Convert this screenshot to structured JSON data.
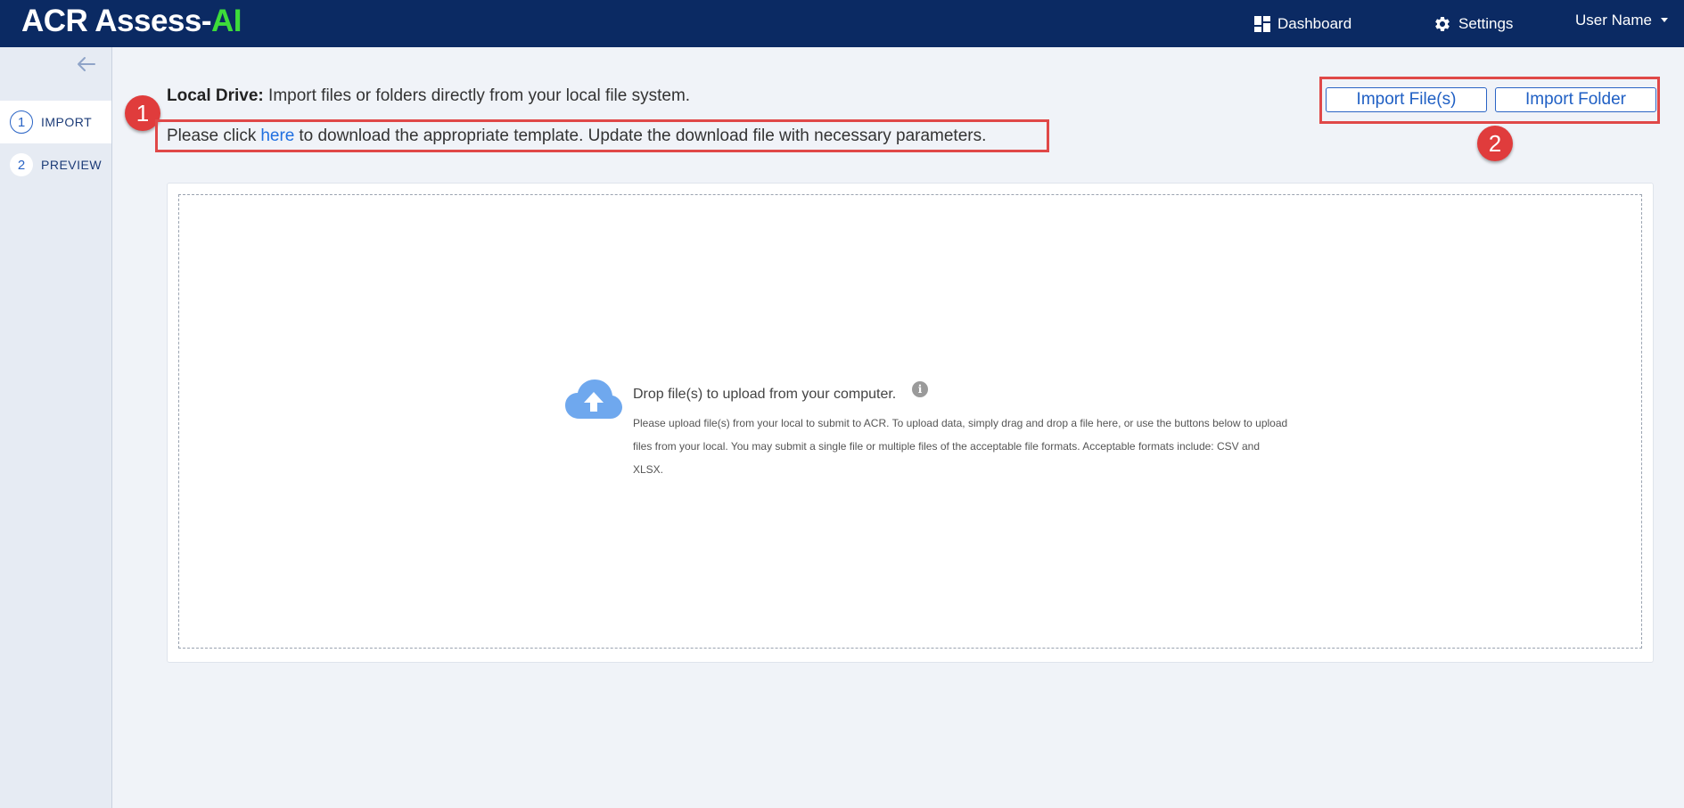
{
  "header": {
    "brand_prefix": "ACR Assess-",
    "brand_suffix": "AI",
    "nav": {
      "dashboard": "Dashboard",
      "settings": "Settings",
      "user": "User Name"
    }
  },
  "sidebar": {
    "steps": [
      {
        "number": "1",
        "label": "IMPORT",
        "active": true
      },
      {
        "number": "2",
        "label": "PREVIEW",
        "active": false
      }
    ]
  },
  "main": {
    "source_label": "Local Drive:",
    "source_desc": " Import files or folders directly from your local file system.",
    "template_prefix": "Please click",
    "template_link": "here",
    "template_suffix": "to download the appropriate template. Update the download file with necessary parameters.",
    "import_files_label": "Import File(s)",
    "import_folder_label": "Import Folder",
    "callouts": [
      "1",
      "2"
    ]
  },
  "dropzone": {
    "title": "Drop file(s) to upload from your computer.",
    "description": "Please upload file(s) from your local to submit to ACR. To upload data, simply drag and drop a file here, or use the buttons below to upload files from your local. You may submit a single file or multiple files of the acceptable file formats. Acceptable formats include: CSV and XLSX.",
    "info_glyph": "i",
    "icon": "cloud-upload-icon"
  },
  "colors": {
    "topbar": "#0b2a63",
    "brand_ai": "#3ddc3a",
    "accent": "#2a64c5",
    "callout": "#e04848"
  }
}
